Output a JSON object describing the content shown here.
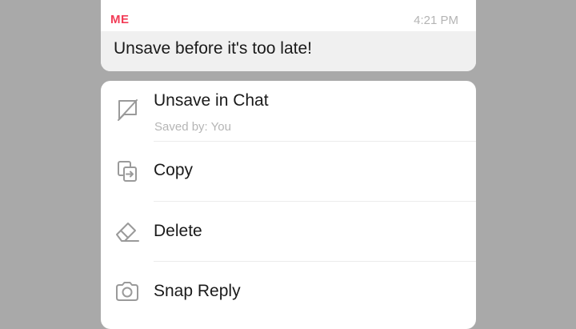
{
  "message": {
    "sender": "ME",
    "time": "4:21 PM",
    "text": "Unsave before it's too late!"
  },
  "menu": {
    "items": [
      {
        "label": "Unsave in Chat",
        "sublabel": "Saved by: You",
        "icon": "unsave-icon"
      },
      {
        "label": "Copy",
        "icon": "copy-icon"
      },
      {
        "label": "Delete",
        "icon": "eraser-icon"
      },
      {
        "label": "Snap Reply",
        "icon": "camera-icon"
      }
    ]
  },
  "colors": {
    "sender": "#f23c57",
    "backdrop": "#a9a9a9",
    "message_bg": "#f0f0f0",
    "icon_gray": "#9a9a9a"
  }
}
